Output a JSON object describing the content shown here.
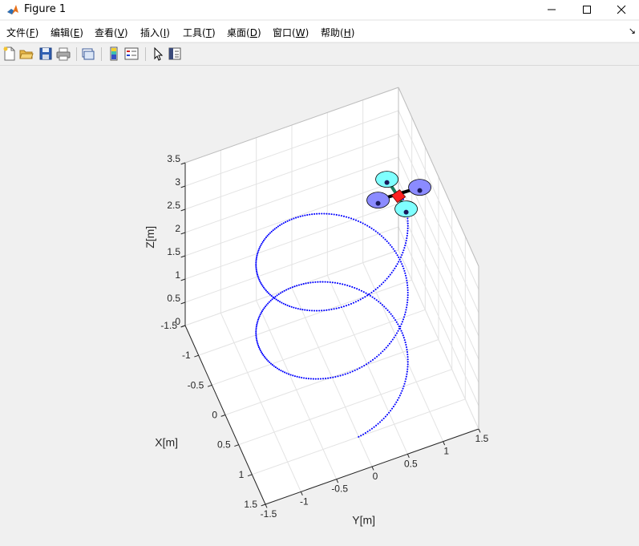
{
  "window": {
    "title": "Figure 1"
  },
  "menu": [
    {
      "label": "文件(",
      "accel": "F",
      "tail": ")"
    },
    {
      "label": "编辑(",
      "accel": "E",
      "tail": ")"
    },
    {
      "label": "查看(",
      "accel": "V",
      "tail": ")"
    },
    {
      "label": "插入(",
      "accel": "I",
      "tail": ")"
    },
    {
      "label": "工具(",
      "accel": "T",
      "tail": ")"
    },
    {
      "label": "桌面(",
      "accel": "D",
      "tail": ")"
    },
    {
      "label": "窗口(",
      "accel": "W",
      "tail": ")"
    },
    {
      "label": "帮助(",
      "accel": "H",
      "tail": ")"
    }
  ],
  "toolbar_icons": [
    "new-figure-icon",
    "open-icon",
    "save-icon",
    "print-icon",
    "link-plot-icon",
    "colorbar-icon",
    "legend-icon",
    "edit-plot-icon",
    "property-inspector-icon"
  ],
  "chart_data": {
    "type": "scatter",
    "title": "",
    "xlabel": "X[m]",
    "ylabel": "Y[m]",
    "zlabel": "Z[m]",
    "xlim": [
      -1.5,
      1.5
    ],
    "ylim": [
      -1.5,
      1.5
    ],
    "zlim": [
      0,
      3.5
    ],
    "xticks": [
      "-1.5",
      "-1",
      "-0.5",
      "0",
      "0.5",
      "1",
      "1.5"
    ],
    "yticks": [
      "-1.5",
      "-1",
      "-0.5",
      "0",
      "0.5",
      "1",
      "1.5"
    ],
    "zticks": [
      "0",
      "0.5",
      "1",
      "1.5",
      "2",
      "2.5",
      "3",
      "3.5"
    ],
    "grid": true,
    "series": [
      {
        "marker": "dotted trajectory",
        "color": "#0000ff",
        "shape": "helix",
        "center": [
          0,
          0
        ],
        "radius": 1,
        "start": [
          1,
          0,
          0
        ],
        "end": [
          -0.05,
          0.95,
          3.3
        ],
        "turns": 2.25
      }
    ],
    "vehicle": {
      "type": "quadrotor",
      "position": [
        -0.05,
        0.95,
        3.3
      ],
      "rotor_colors": [
        "#8b8bff",
        "#7fffff"
      ],
      "body_color": "#ff2020",
      "arm_colors": [
        "#000000",
        "#1a7a5a"
      ]
    }
  },
  "colors": {
    "background": "#f0f0f0",
    "trajectory": "#0000ff"
  }
}
